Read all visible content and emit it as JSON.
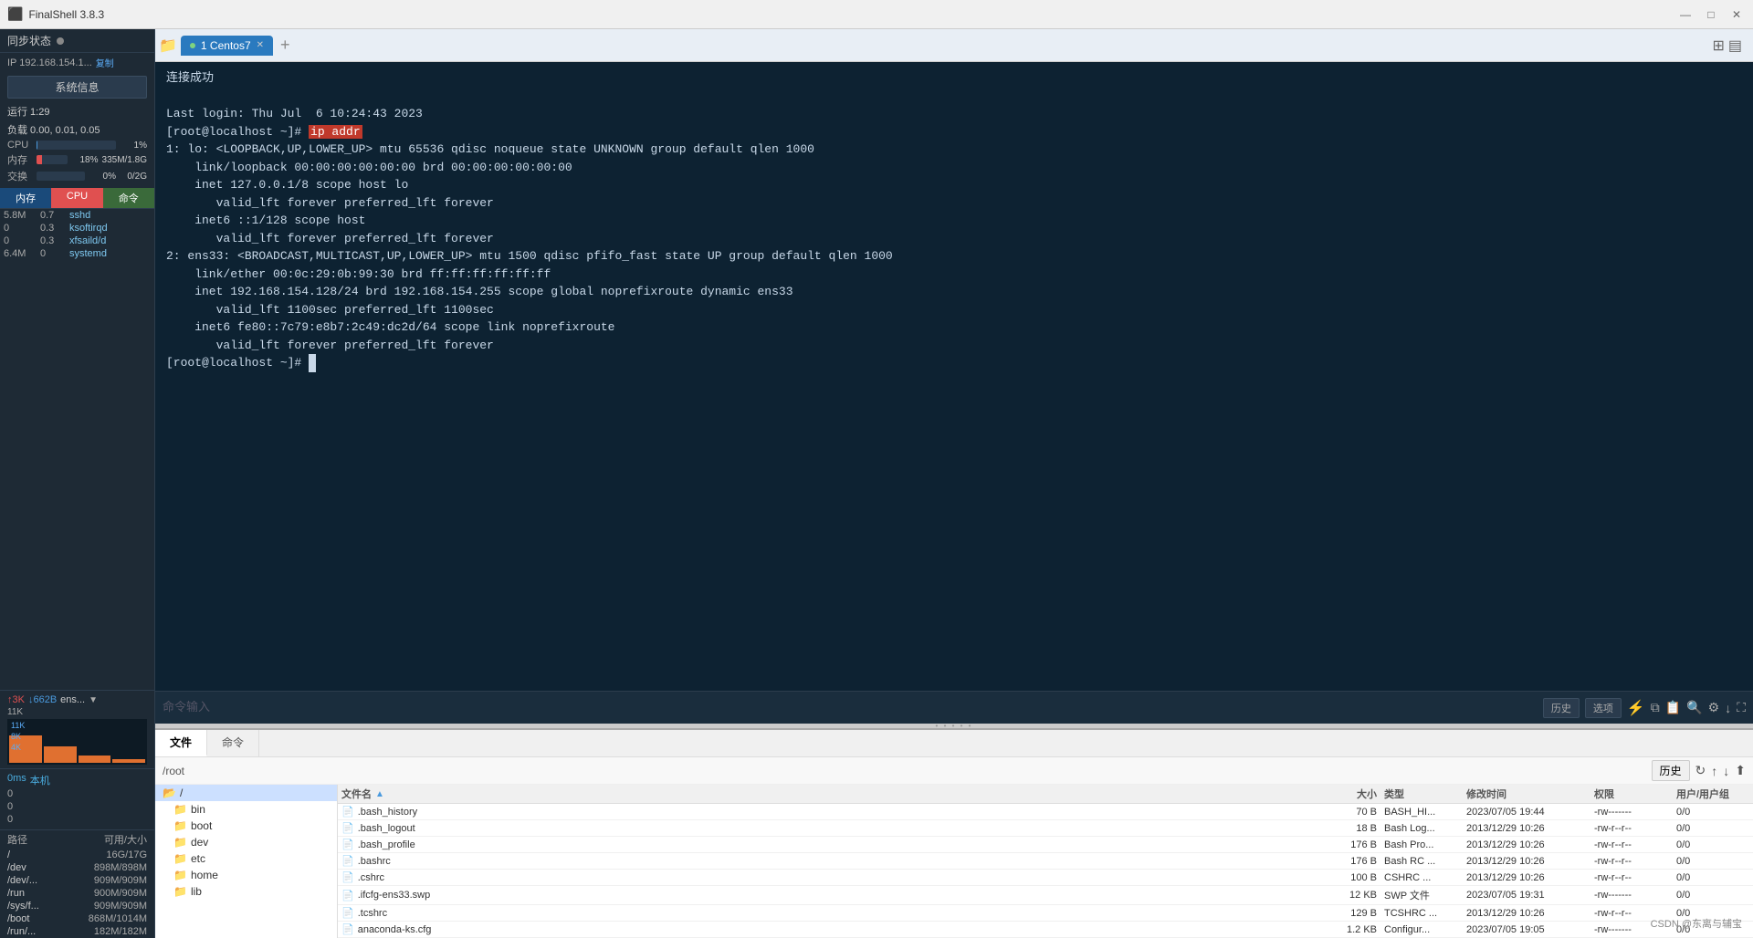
{
  "titleBar": {
    "title": "FinalShell 3.8.3",
    "minimizeLabel": "—",
    "maximizeLabel": "□",
    "closeLabel": "✕"
  },
  "sidebar": {
    "syncLabel": "同步状态",
    "ipLabel": "IP 192.168.154.1...",
    "copyLabel": "复制",
    "sysinfoLabel": "系统信息",
    "uptimeLabel": "运行 1:29",
    "loadLabel": "负载 0.00, 0.01, 0.05",
    "cpuLabel": "CPU",
    "cpuValue": "1%",
    "memLabel": "内存",
    "memPercent": "18%",
    "memValue": "335M/1.8G",
    "swapLabel": "交换",
    "swapPercent": "0%",
    "swapValue": "0/2G",
    "tabs": [
      "内存",
      "CPU",
      "命令"
    ],
    "activeTab": 1,
    "processes": [
      {
        "mem": "5.8M",
        "cpu": "0.7",
        "name": "sshd"
      },
      {
        "mem": "0",
        "cpu": "0.3",
        "name": "ksoftirqd"
      },
      {
        "mem": "0",
        "cpu": "0.3",
        "name": "xfsaild/d"
      },
      {
        "mem": "6.4M",
        "cpu": "0",
        "name": "systemd"
      }
    ],
    "netUp": "↑3K",
    "netDown": "↓662B",
    "netName": "ens...",
    "netLines": [
      "11K",
      "8K",
      "4K"
    ],
    "latency": "0ms",
    "latencyHost": "本机",
    "latencyValues": [
      "0",
      "0",
      "0"
    ],
    "diskHeader": [
      "路径",
      "可用/大小"
    ],
    "disks": [
      {
        "path": "/",
        "avail": "16G/17G"
      },
      {
        "path": "/dev",
        "avail": "898M/898M"
      },
      {
        "path": "/dev/...",
        "avail": "909M/909M"
      },
      {
        "path": "/run",
        "avail": "900M/909M"
      },
      {
        "path": "/sys/f...",
        "avail": "909M/909M"
      },
      {
        "path": "/boot",
        "avail": "868M/1014M"
      },
      {
        "path": "/run/...",
        "avail": "182M/182M"
      }
    ]
  },
  "tabs": [
    {
      "label": "1 Centos7",
      "active": true
    }
  ],
  "terminal": {
    "lines": [
      {
        "type": "text",
        "content": "连接成功"
      },
      {
        "type": "text",
        "content": ""
      },
      {
        "type": "text",
        "content": "Last login: Thu Jul  6 10:24:43 2023"
      },
      {
        "type": "prompt",
        "prompt": "[root@localhost ~]# ",
        "cmd": "ip addr",
        "cmdHighlight": true
      },
      {
        "type": "text",
        "content": "1: lo: <LOOPBACK,UP,LOWER_UP> mtu 65536 qdisc noqueue state UNKNOWN group default qlen 1000"
      },
      {
        "type": "text",
        "content": "    link/loopback 00:00:00:00:00:00 brd 00:00:00:00:00:00"
      },
      {
        "type": "text",
        "content": "    inet 127.0.0.1/8 scope host lo"
      },
      {
        "type": "text",
        "content": "       valid_lft forever preferred_lft forever"
      },
      {
        "type": "text",
        "content": "    inet6 ::1/128 scope host"
      },
      {
        "type": "text",
        "content": "       valid_lft forever preferred_lft forever"
      },
      {
        "type": "text",
        "content": "2: ens33: <BROADCAST,MULTICAST,UP,LOWER_UP> mtu 1500 qdisc pfifo_fast state UP group default qlen 1000"
      },
      {
        "type": "text",
        "content": "    link/ether 00:0c:29:0b:99:30 brd ff:ff:ff:ff:ff:ff"
      },
      {
        "type": "text",
        "content": "    inet 192.168.154.128/24 brd 192.168.154.255 scope global noprefixroute dynamic ens33"
      },
      {
        "type": "text",
        "content": "       valid_lft 1100sec preferred_lft 1100sec"
      },
      {
        "type": "text",
        "content": "    inet6 fe80::7c79:e8b7:2c49:dc2d/64 scope link noprefixroute"
      },
      {
        "type": "text",
        "content": "       valid_lft forever preferred_lft forever"
      },
      {
        "type": "prompt",
        "prompt": "[root@localhost ~]# ",
        "cmd": "",
        "cursor": true
      }
    ]
  },
  "cmdBar": {
    "placeholder": "命令输入",
    "historyLabel": "历史",
    "optionsLabel": "选项"
  },
  "filePanel": {
    "tabs": [
      "文件",
      "命令"
    ],
    "activeTab": 0,
    "pathValue": "/root",
    "historyLabel": "历史",
    "treeItems": [
      {
        "label": "/",
        "level": 0,
        "selected": true
      },
      {
        "label": "bin",
        "level": 1
      },
      {
        "label": "boot",
        "level": 1
      },
      {
        "label": "dev",
        "level": 1
      },
      {
        "label": "etc",
        "level": 1
      },
      {
        "label": "home",
        "level": 1
      },
      {
        "label": "lib",
        "level": 1
      }
    ],
    "columns": [
      "文件名 ▲",
      "大小",
      "类型",
      "修改时间",
      "权限",
      "用户/用户组"
    ],
    "files": [
      {
        "name": ".bash_history",
        "size": "70 B",
        "type": "BASH_HI...",
        "mtime": "2023/07/05 19:44",
        "perm": "-rw-------",
        "owner": "0/0"
      },
      {
        "name": ".bash_logout",
        "size": "18 B",
        "type": "Bash Log...",
        "mtime": "2013/12/29 10:26",
        "perm": "-rw-r--r--",
        "owner": "0/0"
      },
      {
        "name": ".bash_profile",
        "size": "176 B",
        "type": "Bash Pro...",
        "mtime": "2013/12/29 10:26",
        "perm": "-rw-r--r--",
        "owner": "0/0"
      },
      {
        "name": ".bashrc",
        "size": "176 B",
        "type": "Bash RC ...",
        "mtime": "2013/12/29 10:26",
        "perm": "-rw-r--r--",
        "owner": "0/0"
      },
      {
        "name": ".cshrc",
        "size": "100 B",
        "type": "CSHRC ...",
        "mtime": "2013/12/29 10:26",
        "perm": "-rw-r--r--",
        "owner": "0/0"
      },
      {
        "name": ".ifcfg-ens33.swp",
        "size": "12 KB",
        "type": "SWP 文件",
        "mtime": "2023/07/05 19:31",
        "perm": "-rw-------",
        "owner": "0/0"
      },
      {
        "name": ".tcshrc",
        "size": "129 B",
        "type": "TCSHRC ...",
        "mtime": "2013/12/29 10:26",
        "perm": "-rw-r--r--",
        "owner": "0/0"
      },
      {
        "name": "anaconda-ks.cfg",
        "size": "1.2 KB",
        "type": "Configur...",
        "mtime": "2023/07/05 19:05",
        "perm": "-rw-------",
        "owner": "0/0"
      }
    ]
  },
  "watermark": "CSDN @东离与辅宝"
}
